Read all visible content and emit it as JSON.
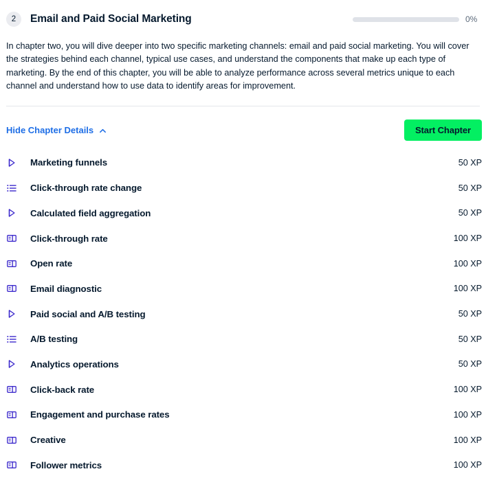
{
  "chapter": {
    "number": "2",
    "title": "Email and Paid Social Marketing",
    "description": "In chapter two, you will dive deeper into two specific marketing channels: email and paid social marketing. You will cover the strategies behind each channel, typical use cases, and understand the components that make up each type of marketing. By the end of this chapter, you will be able to analyze performance across several metrics unique to each channel and understand how to use data to identify areas for improvement.",
    "progress_percent_label": "0%",
    "progress_percent_value": 0
  },
  "actions": {
    "toggle_details_label": "Hide Chapter Details",
    "toggle_details_icon": "chevron-up-icon",
    "start_chapter_label": "Start Chapter"
  },
  "colors": {
    "accent_green": "#03ef62",
    "link_blue": "#1e6ee6",
    "icon_indigo": "#3b28cc",
    "text_navy": "#05192d",
    "track_gray": "#dfe2e8",
    "badge_gray": "#ebecf0"
  },
  "exercises": [
    {
      "icon": "video-play-icon",
      "title": "Marketing funnels",
      "xp": "50 XP"
    },
    {
      "icon": "list-lines-icon",
      "title": "Click-through rate change",
      "xp": "50 XP"
    },
    {
      "icon": "video-play-icon",
      "title": "Calculated field aggregation",
      "xp": "50 XP"
    },
    {
      "icon": "split-panel-icon",
      "title": "Click-through rate",
      "xp": "100 XP"
    },
    {
      "icon": "split-panel-icon",
      "title": "Open rate",
      "xp": "100 XP"
    },
    {
      "icon": "split-panel-icon",
      "title": "Email diagnostic",
      "xp": "100 XP"
    },
    {
      "icon": "video-play-icon",
      "title": "Paid social and A/B testing",
      "xp": "50 XP"
    },
    {
      "icon": "list-lines-icon",
      "title": "A/B testing",
      "xp": "50 XP"
    },
    {
      "icon": "video-play-icon",
      "title": "Analytics operations",
      "xp": "50 XP"
    },
    {
      "icon": "split-panel-icon",
      "title": "Click-back rate",
      "xp": "100 XP"
    },
    {
      "icon": "split-panel-icon",
      "title": "Engagement and purchase rates",
      "xp": "100 XP"
    },
    {
      "icon": "split-panel-icon",
      "title": "Creative",
      "xp": "100 XP"
    },
    {
      "icon": "split-panel-icon",
      "title": "Follower metrics",
      "xp": "100 XP"
    }
  ]
}
